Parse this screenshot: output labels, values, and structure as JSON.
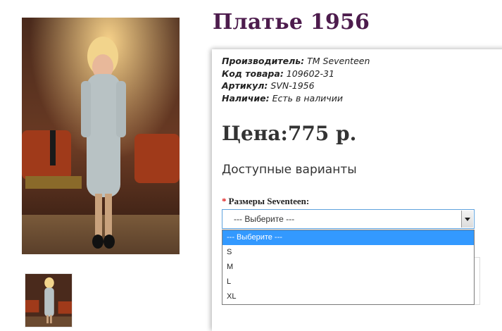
{
  "product": {
    "title": "Платье 1956",
    "manufacturer_label": "Производитель:",
    "manufacturer": "ТМ Seventeen",
    "code_label": "Код товара:",
    "code": "109602-31",
    "article_label": "Артикул:",
    "article": "SVN-1956",
    "availability_label": "Наличие:",
    "availability": "Есть в наличии",
    "price": "Цена:775 р."
  },
  "options": {
    "heading": "Доступные варианты",
    "required_mark": "*",
    "size_label": "Размеры Seventeen:",
    "selected": "--- Выберите ---",
    "items": [
      "--- Выберите ---",
      "S",
      "M",
      "L",
      "XL"
    ]
  },
  "colors": {
    "title": "#4d1c4d",
    "highlight": "#3399ff",
    "select_border": "#5fa2dd"
  },
  "icons": {
    "dropdown_arrow": "chevron-down-icon"
  }
}
